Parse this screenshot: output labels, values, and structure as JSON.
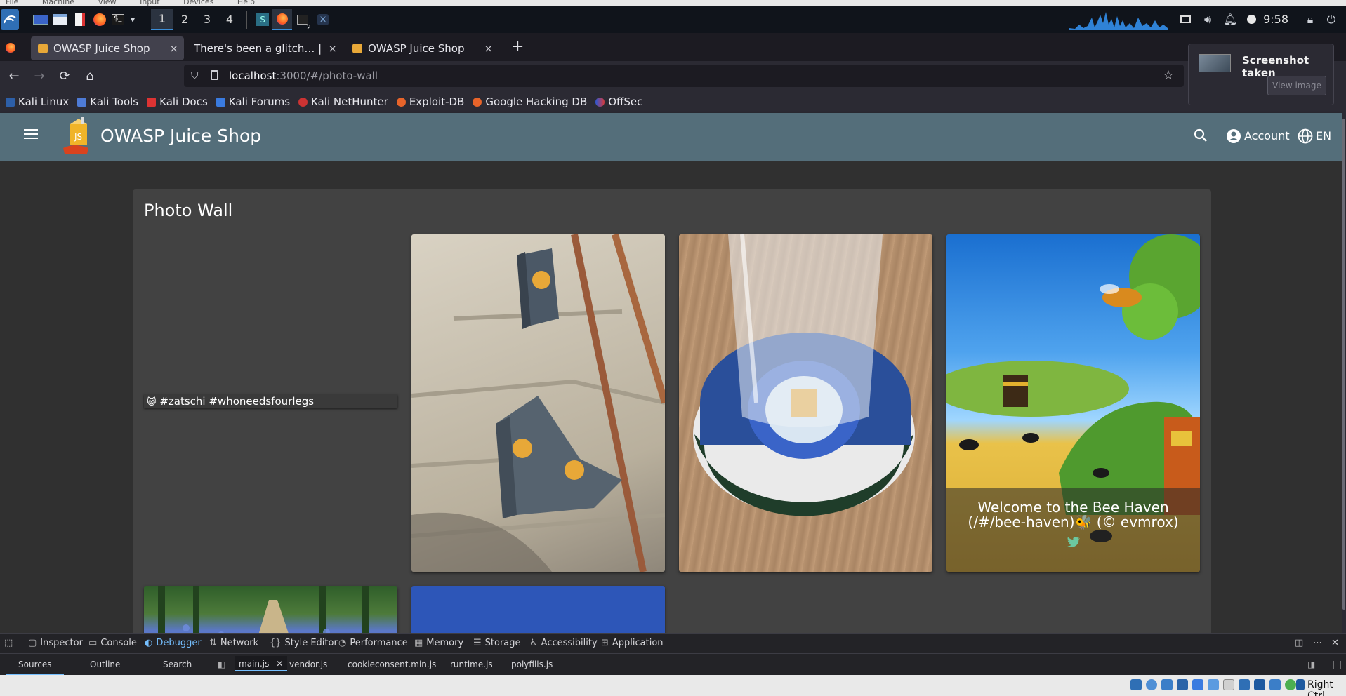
{
  "vm_menu": {
    "items": [
      "File",
      "Machine",
      "View",
      "Input",
      "Devices",
      "Help"
    ]
  },
  "panel": {
    "workspaces": [
      "1",
      "2",
      "3",
      "4"
    ],
    "active_workspace": "1",
    "terminal_badge": "2",
    "clock": "9:58"
  },
  "browser": {
    "tabs": [
      {
        "title": "OWASP Juice Shop",
        "active": true,
        "close": "×"
      },
      {
        "title": "There's been a glitch… | Slack",
        "active": false,
        "close": "×"
      },
      {
        "title": "OWASP Juice Shop",
        "active": false,
        "close": "×"
      }
    ],
    "new_tab": "+",
    "url_host": "localhost",
    "url_rest": ":3000/#/photo-wall",
    "bookmarks": [
      "Kali Linux",
      "Kali Tools",
      "Kali Docs",
      "Kali Forums",
      "Kali NetHunter",
      "Exploit-DB",
      "Google Hacking DB",
      "OffSec"
    ]
  },
  "toast": {
    "title": "Screenshot taken",
    "action": "View image"
  },
  "app": {
    "title": "OWASP Juice Shop",
    "account_label": "Account",
    "language_label": "EN"
  },
  "photo_wall": {
    "heading": "Photo Wall",
    "caption_emoji": "😺",
    "caption": "#zatschi #whoneedsfourlegs",
    "bee_caption_line1": "Welcome to the Bee Haven",
    "bee_caption_line2": "(/#/bee-haven)🐝 (© evmrox)"
  },
  "devtools": {
    "tabs": [
      "Inspector",
      "Console",
      "Debugger",
      "Network",
      "Style Editor",
      "Performance",
      "Memory",
      "Storage",
      "Accessibility",
      "Application"
    ],
    "active_tab": "Debugger",
    "sub_tabs": [
      "Sources",
      "Outline",
      "Search"
    ],
    "active_sub_tab": "Sources",
    "files": [
      "main.js",
      "vendor.js",
      "cookieconsent.min.js",
      "runtime.js",
      "polyfills.js"
    ],
    "active_file": "main.js"
  },
  "vm_status": {
    "host_key": "Right Ctrl"
  },
  "colors": {
    "toolbar": "#546e7a",
    "card": "#424242",
    "background": "#303030",
    "accent_blue": "#75bfff"
  }
}
